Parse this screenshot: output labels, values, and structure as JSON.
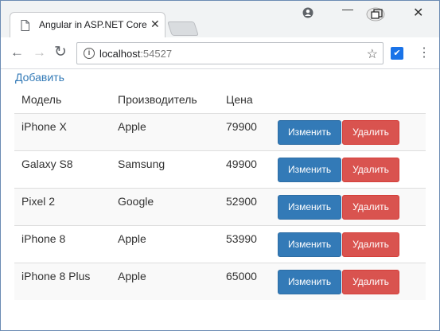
{
  "browser": {
    "tab_title": "Angular in ASP.NET Core",
    "url_host": "localhost",
    "url_port": ":54527"
  },
  "page": {
    "add_link": "Добавить",
    "columns": [
      "Модель",
      "Производитель",
      "Цена"
    ],
    "rows": [
      {
        "model": "iPhone X",
        "maker": "Apple",
        "price": "79900"
      },
      {
        "model": "Galaxy S8",
        "maker": "Samsung",
        "price": "49900"
      },
      {
        "model": "Pixel 2",
        "maker": "Google",
        "price": "52900"
      },
      {
        "model": "iPhone 8",
        "maker": "Apple",
        "price": "53990"
      },
      {
        "model": "iPhone 8 Plus",
        "maker": "Apple",
        "price": "65000"
      }
    ],
    "edit_label": "Изменить",
    "delete_label": "Удалить"
  },
  "colors": {
    "link": "#337ab7",
    "primary": "#337ab7",
    "danger": "#d9534f"
  }
}
